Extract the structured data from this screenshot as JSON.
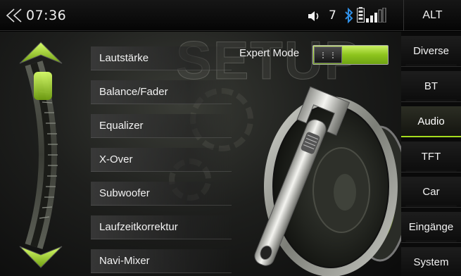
{
  "status_bar": {
    "time": "07:36",
    "volume": "7",
    "alt_label": "ALT",
    "icons": [
      "back-chevron-icon",
      "speaker-volume-icon",
      "bluetooth-icon",
      "battery-icon",
      "signal-strength-icon"
    ]
  },
  "background_title": "SETUP",
  "expert_mode": {
    "label": "Expert Mode",
    "enabled": true
  },
  "menu": {
    "items": [
      {
        "label": "Lautstärke"
      },
      {
        "label": "Balance/Fader"
      },
      {
        "label": "Equalizer"
      },
      {
        "label": "X-Over"
      },
      {
        "label": "Subwoofer"
      },
      {
        "label": "Laufzeitkorrektur"
      },
      {
        "label": "Navi-Mixer"
      }
    ]
  },
  "sidenav": {
    "items": [
      {
        "label": "Diverse"
      },
      {
        "label": "BT"
      },
      {
        "label": "Audio",
        "active": true
      },
      {
        "label": "TFT"
      },
      {
        "label": "Car"
      },
      {
        "label": "Eingänge"
      },
      {
        "label": "System"
      }
    ]
  },
  "colors": {
    "accent": "#a4dc1e",
    "toggle_green": "#8dc41d",
    "bluetooth": "#2f8fe6"
  }
}
